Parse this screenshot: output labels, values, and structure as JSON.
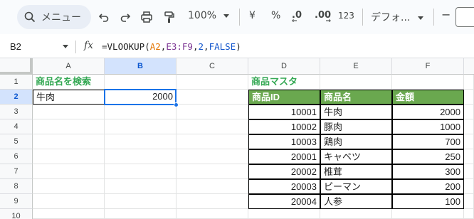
{
  "toolbar": {
    "menu_label": "メニュー",
    "zoom": "100%",
    "currency_symbol": "¥",
    "percent_symbol": "%",
    "decrease_decimal": ".0",
    "increase_decimal": ".00",
    "number_format": "123",
    "font_name": "デフォ...",
    "font_size_minus": "−"
  },
  "formula_bar": {
    "cell_ref": "B2",
    "fx": "fx",
    "formula_prefix": "=VLOOKUP(",
    "formula_arg1": "A2",
    "formula_comma1": ",",
    "formula_arg2": "E3:F9",
    "formula_comma2": ",",
    "formula_arg3": "2",
    "formula_comma3": ",",
    "formula_arg4": "FALSE",
    "formula_suffix": ")"
  },
  "columns": [
    "A",
    "B",
    "C",
    "D",
    "E",
    "F"
  ],
  "rows": [
    "1",
    "2",
    "3",
    "4",
    "5",
    "6",
    "7",
    "8",
    "9",
    "10"
  ],
  "search": {
    "title": "商品名を検索",
    "input_value": "牛肉",
    "result": "2000"
  },
  "master": {
    "title": "商品マスタ",
    "headers": [
      "商品ID",
      "商品名",
      "金額"
    ],
    "rows": [
      {
        "id": "10001",
        "name": "牛肉",
        "price": "2000"
      },
      {
        "id": "10002",
        "name": "豚肉",
        "price": "1000"
      },
      {
        "id": "10003",
        "name": "鶏肉",
        "price": "700"
      },
      {
        "id": "20001",
        "name": "キャベツ",
        "price": "250"
      },
      {
        "id": "20002",
        "name": "椎茸",
        "price": "300"
      },
      {
        "id": "20003",
        "name": "ピーマン",
        "price": "200"
      },
      {
        "id": "20004",
        "name": "人参",
        "price": "100"
      }
    ]
  },
  "colors": {
    "header_green": "#6aa84f",
    "title_green": "#34a853",
    "selection_blue": "#1a73e8"
  }
}
